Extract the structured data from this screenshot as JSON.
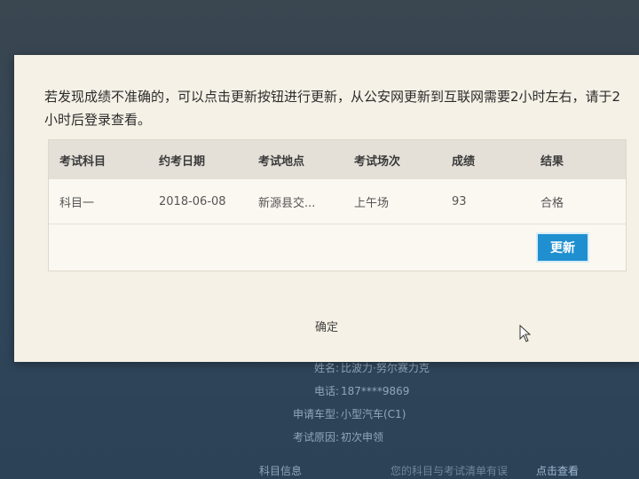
{
  "dialog": {
    "notice": "若发现成绩不准确的，可以点击更新按钮进行更新，从公安网更新到互联网需要2小时左右，请于2小时后登录查看。",
    "table": {
      "headers": [
        "考试科目",
        "约考日期",
        "考试地点",
        "考试场次",
        "成绩",
        "结果"
      ],
      "rows": [
        [
          "科目一",
          "2018-06-08",
          "新源县交...",
          "上午场",
          "93",
          "合格"
        ]
      ]
    },
    "update_label": "更新",
    "confirm_label": "确定"
  },
  "background": {
    "info": [
      {
        "key": "姓名:",
        "value": "比波力·努尔赛力克"
      },
      {
        "key": "电话:",
        "value": "187****9869"
      },
      {
        "key": "申请车型:",
        "value": "小型汽车(C1)"
      },
      {
        "key": "考试原因:",
        "value": "初次申领"
      }
    ],
    "bottom_left": "科目信息",
    "bottom_right": "您的科目与考试清单有误",
    "bottom_link": "点击查看"
  },
  "colors": {
    "accent": "#1f8fd0",
    "dialog_bg": "#f6f1e6"
  }
}
